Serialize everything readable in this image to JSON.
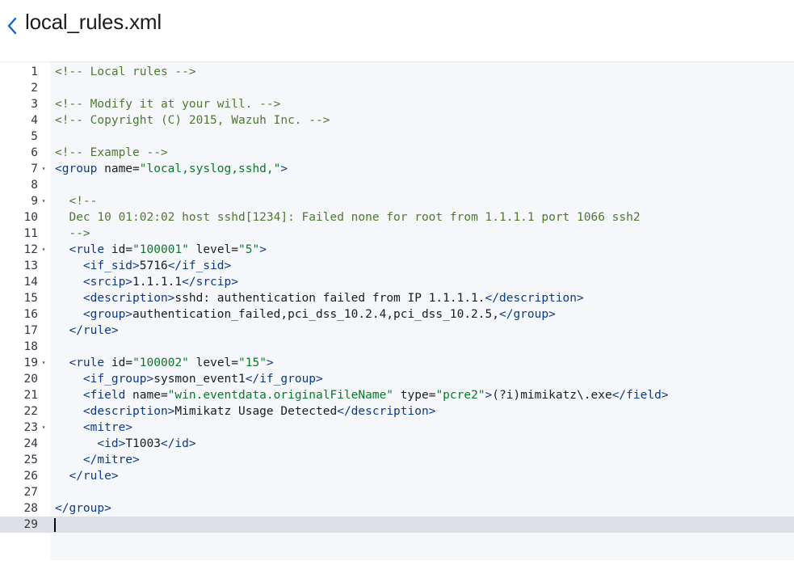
{
  "header": {
    "back_icon": "chevron-left-icon",
    "title": "local_rules.xml"
  },
  "colors": {
    "comment": "#4d7a2e",
    "tag": "#0b3a8a",
    "string": "#097a2a",
    "text": "#1a1c21",
    "active_line": "#dde1e7",
    "editor_bg": "#f5f7fa"
  },
  "editor": {
    "active_line": 29,
    "lines": [
      {
        "n": "1",
        "fold": false,
        "indent": 0,
        "tokens": [
          {
            "t": "c",
            "v": "<!-- Local rules -->"
          }
        ]
      },
      {
        "n": "2",
        "fold": false,
        "indent": 0,
        "tokens": []
      },
      {
        "n": "3",
        "fold": false,
        "indent": 0,
        "tokens": [
          {
            "t": "c",
            "v": "<!-- Modify it at your will. -->"
          }
        ]
      },
      {
        "n": "4",
        "fold": false,
        "indent": 0,
        "tokens": [
          {
            "t": "c",
            "v": "<!-- Copyright (C) 2015, Wazuh Inc. -->"
          }
        ]
      },
      {
        "n": "5",
        "fold": false,
        "indent": 0,
        "tokens": []
      },
      {
        "n": "6",
        "fold": false,
        "indent": 0,
        "tokens": [
          {
            "t": "c",
            "v": "<!-- Example -->"
          }
        ]
      },
      {
        "n": "7",
        "fold": true,
        "indent": 0,
        "tokens": [
          {
            "t": "g",
            "v": "<group "
          },
          {
            "t": "a",
            "v": "name="
          },
          {
            "t": "s",
            "v": "\"local,syslog,sshd,\""
          },
          {
            "t": "g",
            "v": ">"
          }
        ]
      },
      {
        "n": "8",
        "fold": false,
        "indent": 0,
        "tokens": []
      },
      {
        "n": "9",
        "fold": true,
        "indent": 2,
        "tokens": [
          {
            "t": "c",
            "v": "<!--"
          }
        ]
      },
      {
        "n": "10",
        "fold": false,
        "indent": 2,
        "tokens": [
          {
            "t": "c",
            "v": "Dec 10 01:02:02 host sshd[1234]: Failed none for root from 1.1.1.1 port 1066 ssh2"
          }
        ]
      },
      {
        "n": "11",
        "fold": false,
        "indent": 2,
        "tokens": [
          {
            "t": "c",
            "v": "-->"
          }
        ]
      },
      {
        "n": "12",
        "fold": true,
        "indent": 2,
        "tokens": [
          {
            "t": "g",
            "v": "<rule "
          },
          {
            "t": "a",
            "v": "id="
          },
          {
            "t": "s",
            "v": "\"100001\""
          },
          {
            "t": "a",
            "v": " level="
          },
          {
            "t": "s",
            "v": "\"5\""
          },
          {
            "t": "g",
            "v": ">"
          }
        ]
      },
      {
        "n": "13",
        "fold": false,
        "indent": 4,
        "tokens": [
          {
            "t": "g",
            "v": "<if_sid>"
          },
          {
            "t": "x",
            "v": "5716"
          },
          {
            "t": "g",
            "v": "</if_sid>"
          }
        ]
      },
      {
        "n": "14",
        "fold": false,
        "indent": 4,
        "tokens": [
          {
            "t": "g",
            "v": "<srcip>"
          },
          {
            "t": "x",
            "v": "1.1.1.1"
          },
          {
            "t": "g",
            "v": "</srcip>"
          }
        ]
      },
      {
        "n": "15",
        "fold": false,
        "indent": 4,
        "tokens": [
          {
            "t": "g",
            "v": "<description>"
          },
          {
            "t": "x",
            "v": "sshd: authentication failed from IP 1.1.1.1."
          },
          {
            "t": "g",
            "v": "</description>"
          }
        ]
      },
      {
        "n": "16",
        "fold": false,
        "indent": 4,
        "tokens": [
          {
            "t": "g",
            "v": "<group>"
          },
          {
            "t": "x",
            "v": "authentication_failed,pci_dss_10.2.4,pci_dss_10.2.5,"
          },
          {
            "t": "g",
            "v": "</group>"
          }
        ]
      },
      {
        "n": "17",
        "fold": false,
        "indent": 2,
        "tokens": [
          {
            "t": "g",
            "v": "</rule>"
          }
        ]
      },
      {
        "n": "18",
        "fold": false,
        "indent": 0,
        "tokens": []
      },
      {
        "n": "19",
        "fold": true,
        "indent": 2,
        "tokens": [
          {
            "t": "g",
            "v": "<rule "
          },
          {
            "t": "a",
            "v": "id="
          },
          {
            "t": "s",
            "v": "\"100002\""
          },
          {
            "t": "a",
            "v": " level="
          },
          {
            "t": "s",
            "v": "\"15\""
          },
          {
            "t": "g",
            "v": ">"
          }
        ]
      },
      {
        "n": "20",
        "fold": false,
        "indent": 4,
        "tokens": [
          {
            "t": "g",
            "v": "<if_group>"
          },
          {
            "t": "x",
            "v": "sysmon_event1"
          },
          {
            "t": "g",
            "v": "</if_group>"
          }
        ]
      },
      {
        "n": "21",
        "fold": false,
        "indent": 4,
        "tokens": [
          {
            "t": "g",
            "v": "<field "
          },
          {
            "t": "a",
            "v": "name="
          },
          {
            "t": "s",
            "v": "\"win.eventdata.originalFileName\""
          },
          {
            "t": "a",
            "v": " type="
          },
          {
            "t": "s",
            "v": "\"pcre2\""
          },
          {
            "t": "g",
            "v": ">"
          },
          {
            "t": "x",
            "v": "(?i)mimikatz\\.exe"
          },
          {
            "t": "g",
            "v": "</field>"
          }
        ]
      },
      {
        "n": "22",
        "fold": false,
        "indent": 4,
        "tokens": [
          {
            "t": "g",
            "v": "<description>"
          },
          {
            "t": "x",
            "v": "Mimikatz Usage Detected"
          },
          {
            "t": "g",
            "v": "</description>"
          }
        ]
      },
      {
        "n": "23",
        "fold": true,
        "indent": 4,
        "tokens": [
          {
            "t": "g",
            "v": "<mitre>"
          }
        ]
      },
      {
        "n": "24",
        "fold": false,
        "indent": 6,
        "tokens": [
          {
            "t": "g",
            "v": "<id>"
          },
          {
            "t": "x",
            "v": "T1003"
          },
          {
            "t": "g",
            "v": "</id>"
          }
        ]
      },
      {
        "n": "25",
        "fold": false,
        "indent": 4,
        "tokens": [
          {
            "t": "g",
            "v": "</mitre>"
          }
        ]
      },
      {
        "n": "26",
        "fold": false,
        "indent": 2,
        "tokens": [
          {
            "t": "g",
            "v": "</rule>"
          }
        ]
      },
      {
        "n": "27",
        "fold": false,
        "indent": 0,
        "tokens": []
      },
      {
        "n": "28",
        "fold": false,
        "indent": 0,
        "tokens": [
          {
            "t": "g",
            "v": "</group>"
          }
        ]
      },
      {
        "n": "29",
        "fold": false,
        "indent": 0,
        "tokens": []
      }
    ]
  }
}
